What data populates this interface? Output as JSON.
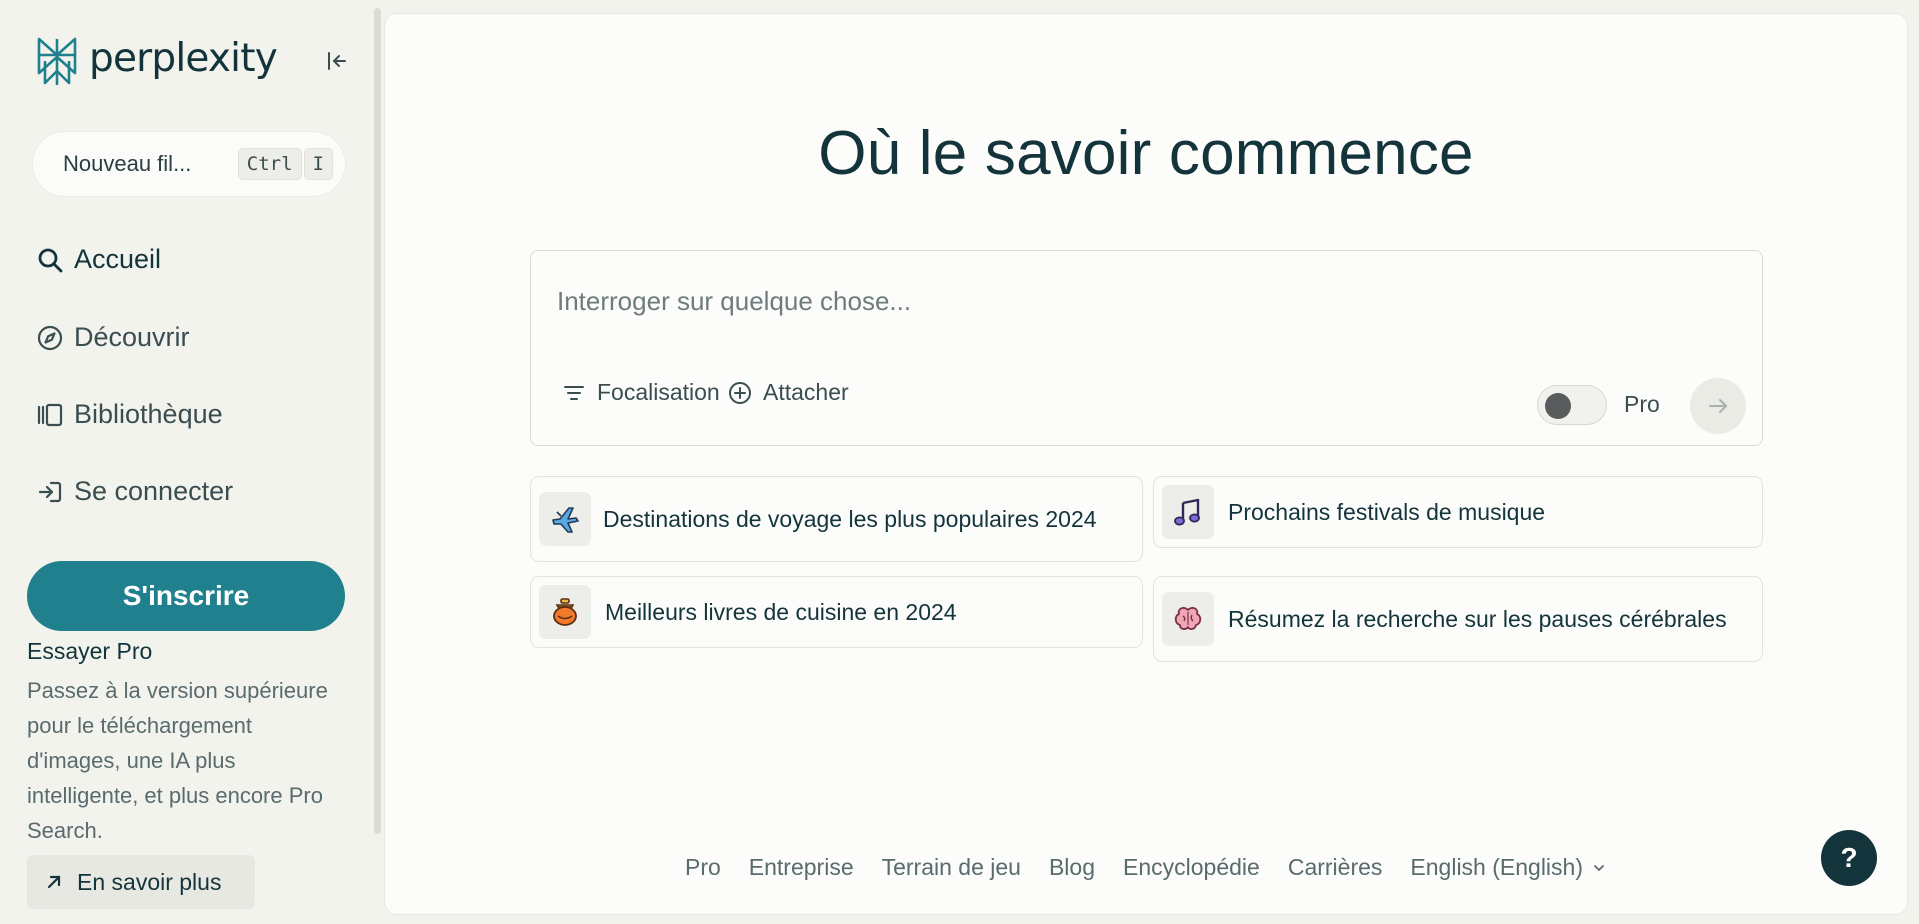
{
  "brand": {
    "name": "perplexity",
    "accent": "#20808d",
    "text_color": "#13343b"
  },
  "sidebar": {
    "collapse_icon": "collapse-sidebar-icon",
    "new_thread": {
      "label": "Nouveau fil...",
      "shortcut": [
        "Ctrl",
        "I"
      ]
    },
    "nav": [
      {
        "label": "Accueil",
        "icon": "search-icon"
      },
      {
        "label": "Découvrir",
        "icon": "compass-icon"
      },
      {
        "label": "Bibliothèque",
        "icon": "library-icon"
      },
      {
        "label": "Se connecter",
        "icon": "sign-in-icon"
      }
    ],
    "signup_label": "S'inscrire",
    "pro_promo": {
      "title": "Essayer Pro",
      "description": "Passez à la version supérieure pour le téléchargement d'images, une IA plus intelligente, et plus encore Pro Search.",
      "learn_more": "En savoir plus"
    }
  },
  "main": {
    "headline": "Où le savoir commence",
    "search": {
      "placeholder": "Interroger sur quelque chose...",
      "value": "",
      "focus_label": "Focalisation",
      "attach_label": "Attacher",
      "pro_label": "Pro",
      "pro_enabled": false
    },
    "suggestions": [
      {
        "text": "Destinations de voyage les plus populaires 2024",
        "icon": "airplane-icon"
      },
      {
        "text": "Prochains festivals de musique",
        "icon": "music-note-icon"
      },
      {
        "text": "Meilleurs livres de cuisine en 2024",
        "icon": "cooking-pot-icon"
      },
      {
        "text": "Résumez la recherche sur les pauses cérébrales",
        "icon": "brain-icon"
      }
    ],
    "footer": {
      "links": [
        "Pro",
        "Entreprise",
        "Terrain de jeu",
        "Blog",
        "Encyclopédie",
        "Carrières"
      ],
      "language": "English (English)"
    }
  },
  "help_label": "?"
}
